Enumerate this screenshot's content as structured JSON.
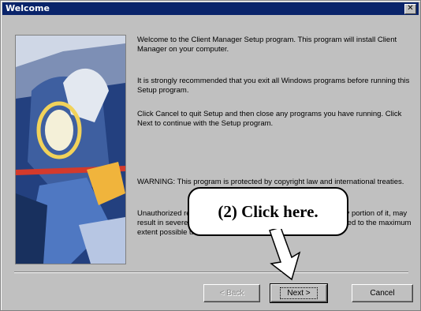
{
  "window": {
    "title": "Welcome",
    "close_glyph": "✕"
  },
  "content": {
    "para1": "Welcome to the Client Manager Setup program. This program will install Client Manager on your computer.",
    "para2": "It is strongly recommended that you exit all Windows programs before running this Setup program.",
    "para3": "Click Cancel to quit Setup and then close any programs you have running. Click Next to continue with the Setup program.",
    "para4": "WARNING: This program is protected by copyright law and international treaties.",
    "para5": "Unauthorized reproduction or distribution of this program, or any portion of it, may result in severe civil and criminal penalties, and will be prosecuted to the maximum extent possible under law."
  },
  "buttons": {
    "back": "< Back",
    "next": "Next >",
    "cancel": "Cancel"
  },
  "annotation": {
    "callout": "(2) Click here."
  },
  "icons": [
    "close-icon",
    "setup-artwork-image",
    "pointer-arrow-icon"
  ]
}
